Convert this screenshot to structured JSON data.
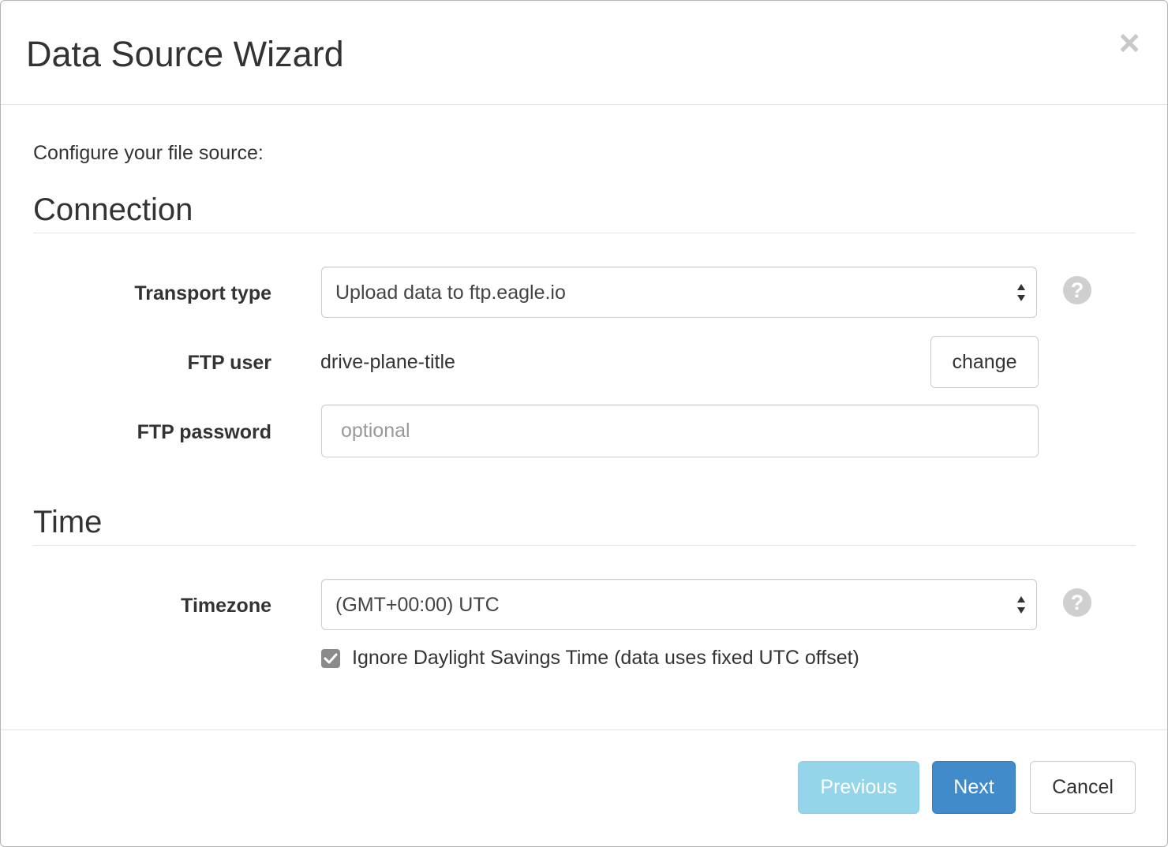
{
  "dialog": {
    "title": "Data Source Wizard",
    "close_glyph": "×"
  },
  "intro": "Configure your file source:",
  "connection": {
    "heading": "Connection",
    "transport_type": {
      "label": "Transport type",
      "value": "Upload data to ftp.eagle.io"
    },
    "ftp_user": {
      "label": "FTP user",
      "value": "drive-plane-title",
      "change_label": "change"
    },
    "ftp_password": {
      "label": "FTP password",
      "placeholder": "optional",
      "value": ""
    },
    "help_glyph": "?"
  },
  "time": {
    "heading": "Time",
    "timezone": {
      "label": "Timezone",
      "value": "(GMT+00:00) UTC"
    },
    "ignore_dst": {
      "label": "Ignore Daylight Savings Time (data uses fixed UTC offset)",
      "checked": true
    },
    "help_glyph": "?"
  },
  "footer": {
    "previous_label": "Previous",
    "next_label": "Next",
    "cancel_label": "Cancel"
  },
  "colors": {
    "info": "#5bc0de",
    "primary": "#428bca",
    "border": "#cccccc",
    "muted": "#999999"
  },
  "icons": {
    "close": "close-icon",
    "help": "question-circle-icon",
    "select_arrows": "sort-arrows-icon",
    "checkbox": "checkmark-icon"
  }
}
